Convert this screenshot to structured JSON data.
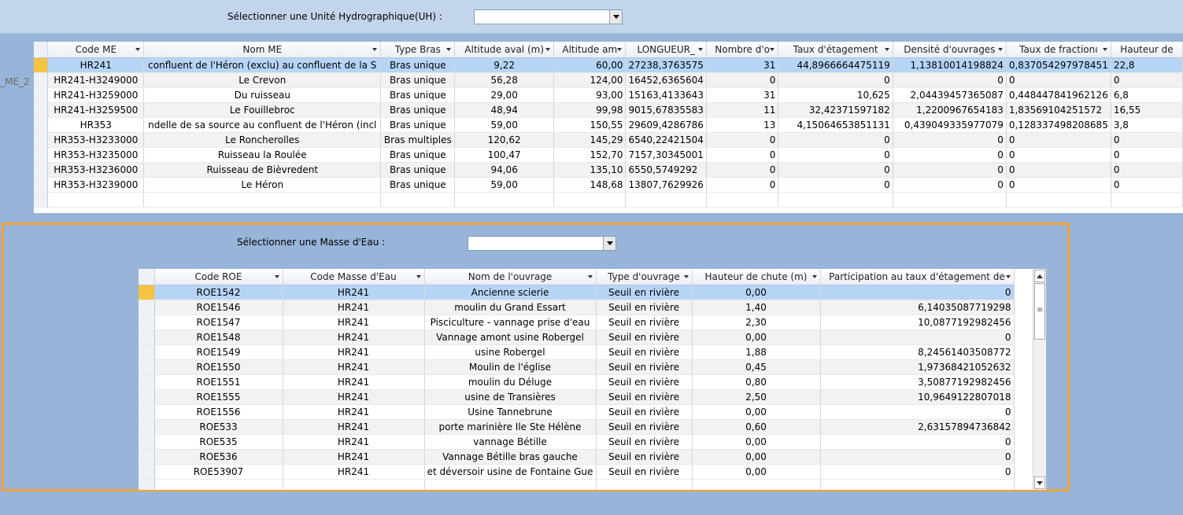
{
  "uh_selector": {
    "label": "Sélectionner une Unité Hydrographique(UH) :",
    "value": ""
  },
  "side_label": "_ME_2",
  "grid1": {
    "columns": [
      "Code ME",
      "Nom ME",
      "Type Bras",
      "Altitude aval (m)",
      "Altitude am",
      "LONGUEUR_",
      "Nombre d'o",
      "Taux d'étagement",
      "Densité d'ouvrages",
      "Taux de fractionı",
      "Hauteur de"
    ],
    "rows": [
      [
        "HR241",
        "confluent de l'Héron (exclu) au confluent de la S",
        "Bras unique",
        "9,22",
        "60,00",
        "27238,3763575",
        "31",
        "44,8966664475119",
        "1,13810014198824",
        "0,837054297978451",
        "22,8"
      ],
      [
        "HR241-H3249000",
        "Le Crevon",
        "Bras unique",
        "56,28",
        "124,00",
        "16452,6365604",
        "0",
        "0",
        "0",
        "0",
        "0"
      ],
      [
        "HR241-H3259000",
        "Du ruisseau",
        "Bras unique",
        "29,00",
        "93,00",
        "15163,4133643",
        "31",
        "10,625",
        "2,04439457365087",
        "0,448447841962126",
        "6,8"
      ],
      [
        "HR241-H3259500",
        "Le Fouillebroc",
        "Bras unique",
        "48,94",
        "99,98",
        "9015,67835583",
        "11",
        "32,42371597182",
        "1,2200967654183",
        "1,83569104251572",
        "16,55"
      ],
      [
        "HR353",
        "ndelle de sa source au confluent de l'Héron (incl",
        "Bras unique",
        "59,00",
        "150,55",
        "29609,4286786",
        "13",
        "4,15064653851131",
        "0,439049335977079",
        "0,128337498208685",
        "3,8"
      ],
      [
        "HR353-H3233000",
        "Le Roncherolles",
        "Bras multiples",
        "120,62",
        "145,29",
        "6540,22421504",
        "0",
        "0",
        "0",
        "0",
        "0"
      ],
      [
        "HR353-H3235000",
        "Ruisseau la Roulée",
        "Bras unique",
        "100,47",
        "152,70",
        "7157,30345001",
        "0",
        "0",
        "0",
        "0",
        "0"
      ],
      [
        "HR353-H3236000",
        "Ruisseau de Bièvredent",
        "Bras unique",
        "94,06",
        "135,10",
        "6550,5749292",
        "0",
        "0",
        "0",
        "0",
        "0"
      ],
      [
        "HR353-H3239000",
        "Le Héron",
        "Bras unique",
        "59,00",
        "148,68",
        "13807,7629926",
        "0",
        "0",
        "0",
        "0",
        "0"
      ]
    ]
  },
  "me_selector": {
    "label": "Sélectionner une Masse d'Eau  :",
    "value": ""
  },
  "grid2": {
    "columns": [
      "Code ROE",
      "Code Masse d'Eau",
      "Nom de l'ouvrage",
      "Type d'ouvrage",
      "Hauteur de chute  (m)",
      "Participation au taux d'étagement de"
    ],
    "rows": [
      [
        "ROE1542",
        "HR241",
        "Ancienne scierie",
        "Seuil en rivière",
        "0,00",
        "0"
      ],
      [
        "ROE1546",
        "HR241",
        "moulin du Grand Essart",
        "Seuil en rivière",
        "1,40",
        "6,14035087719298"
      ],
      [
        "ROE1547",
        "HR241",
        "Pisciculture - vannage prise d'eau",
        "Seuil en rivière",
        "2,30",
        "10,0877192982456"
      ],
      [
        "ROE1548",
        "HR241",
        "Vannage amont usine Robergel",
        "Seuil en rivière",
        "0,00",
        "0"
      ],
      [
        "ROE1549",
        "HR241",
        "usine Robergel",
        "Seuil en rivière",
        "1,88",
        "8,24561403508772"
      ],
      [
        "ROE1550",
        "HR241",
        "Moulin de l'église",
        "Seuil en rivière",
        "0,45",
        "1,97368421052632"
      ],
      [
        "ROE1551",
        "HR241",
        "moulin du Déluge",
        "Seuil en rivière",
        "0,80",
        "3,50877192982456"
      ],
      [
        "ROE1555",
        "HR241",
        "usine de Transières",
        "Seuil en rivière",
        "2,50",
        "10,9649122807018"
      ],
      [
        "ROE1556",
        "HR241",
        "Usine Tannebrune",
        "Seuil en rivière",
        "0,00",
        "0"
      ],
      [
        "ROE533",
        "HR241",
        "porte marinière Ile Ste Hélène",
        "Seuil en rivière",
        "0,60",
        "2,63157894736842"
      ],
      [
        "ROE535",
        "HR241",
        "vannage  Bétille",
        "Seuil en rivière",
        "0,00",
        "0"
      ],
      [
        "ROE536",
        "HR241",
        "Vannage Bétille bras gauche",
        "Seuil en rivière",
        "0,00",
        "0"
      ],
      [
        "ROE53907",
        "HR241",
        "et déversoir usine de Fontaine Gue",
        "Seuil en rivière",
        "0,00",
        "0"
      ]
    ]
  },
  "colors": {
    "background": "#98b4d8",
    "topbar": "#c3d5ec",
    "selected_row": "#b6d5f6",
    "frame": "#f0a33c",
    "record_marker": "#f5c242"
  }
}
